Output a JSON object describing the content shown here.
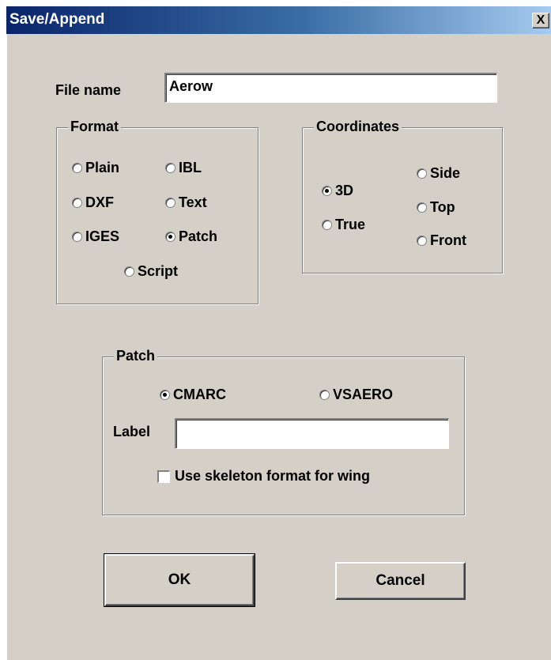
{
  "window": {
    "title": "Save/Append",
    "close_glyph": "X"
  },
  "file_name": {
    "label": "File name",
    "value": "Aerow"
  },
  "format": {
    "legend": "Format",
    "options": [
      "Plain",
      "IBL",
      "DXF",
      "Text",
      "IGES",
      "Patch",
      "Script"
    ],
    "selected": "Patch"
  },
  "coordinates": {
    "legend": "Coordinates",
    "options": [
      "3D",
      "True",
      "Side",
      "Top",
      "Front"
    ],
    "selected": "3D"
  },
  "patch": {
    "legend": "Patch",
    "options": [
      "CMARC",
      "VSAERO"
    ],
    "selected": "CMARC",
    "label_caption": "Label",
    "label_value": "",
    "skeleton_label": "Use skeleton format for wing",
    "skeleton_checked": false
  },
  "buttons": {
    "ok": "OK",
    "cancel": "Cancel"
  }
}
